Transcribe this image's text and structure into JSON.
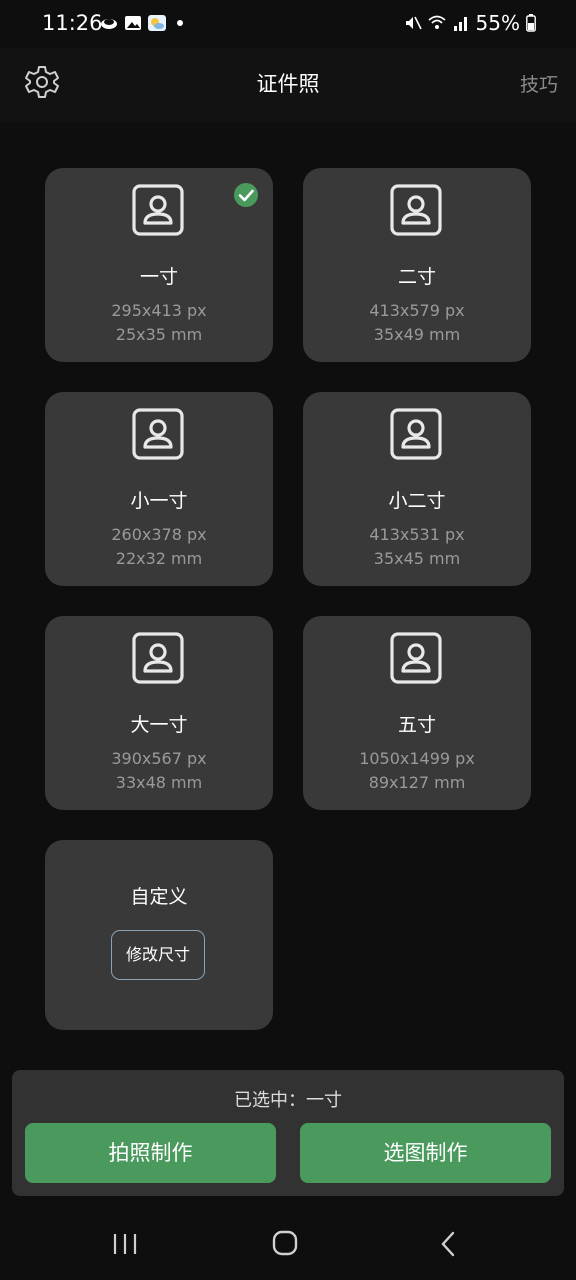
{
  "status_bar": {
    "time": "11:26",
    "battery": "55%"
  },
  "app_bar": {
    "title": "证件照",
    "tips_label": "技巧",
    "settings_icon": "gear-icon"
  },
  "sizes": [
    {
      "name": "一寸",
      "px": "295x413 px",
      "mm": "25x35 mm",
      "selected": true
    },
    {
      "name": "二寸",
      "px": "413x579 px",
      "mm": "35x49 mm",
      "selected": false
    },
    {
      "name": "小一寸",
      "px": "260x378 px",
      "mm": "22x32 mm",
      "selected": false
    },
    {
      "name": "小二寸",
      "px": "413x531 px",
      "mm": "35x45 mm",
      "selected": false
    },
    {
      "name": "大一寸",
      "px": "390x567 px",
      "mm": "33x48 mm",
      "selected": false
    },
    {
      "name": "五寸",
      "px": "1050x1499 px",
      "mm": "89x127 mm",
      "selected": false
    }
  ],
  "custom": {
    "name": "自定义",
    "modify_label": "修改尺寸"
  },
  "bottom": {
    "selected_text": "已选中：一寸",
    "take_photo_label": "拍照制作",
    "pick_image_label": "选图制作"
  },
  "colors": {
    "accent": "#4a9a5e",
    "card": "#393939",
    "background": "#0e0e0e"
  }
}
